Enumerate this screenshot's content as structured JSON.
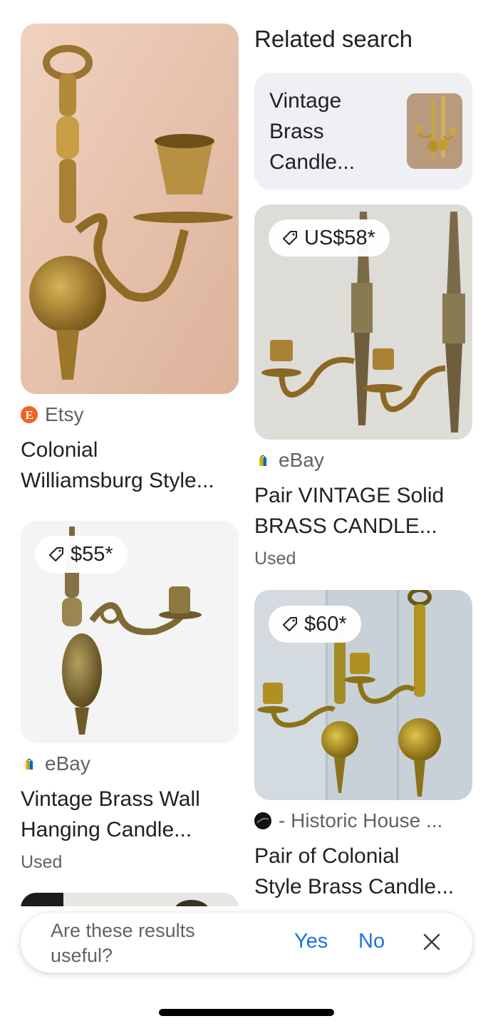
{
  "related": {
    "heading": "Related search",
    "card_label": "Vintage Brass Candle..."
  },
  "results": [
    {
      "source": "Etsy",
      "source_icon": "etsy-icon",
      "title_lines": [
        "Colonial",
        "Williamsburg Style..."
      ]
    },
    {
      "price": "US$58*",
      "source": "eBay",
      "source_icon": "ebay-icon",
      "title_lines": [
        "Pair VINTAGE Solid",
        "BRASS CANDLE..."
      ],
      "condition": "Used"
    },
    {
      "price": "$55*",
      "source": "eBay",
      "source_icon": "ebay-icon",
      "title_lines": [
        "Vintage Brass Wall",
        "Hanging Candle..."
      ],
      "condition": "Used"
    },
    {
      "price": "$60*",
      "source": "- Historic House ...",
      "source_icon": "historic-house-icon",
      "title_lines": [
        "Pair of Colonial",
        "Style Brass Candle..."
      ]
    }
  ],
  "feedback": {
    "question": "Are these results useful?",
    "yes": "Yes",
    "no": "No",
    "close_icon": "close-icon"
  },
  "colors": {
    "link": "#1a73e8",
    "secondary_text": "#5f6368",
    "etsy": "#f1641e",
    "card_bg": "#eef0f3"
  }
}
